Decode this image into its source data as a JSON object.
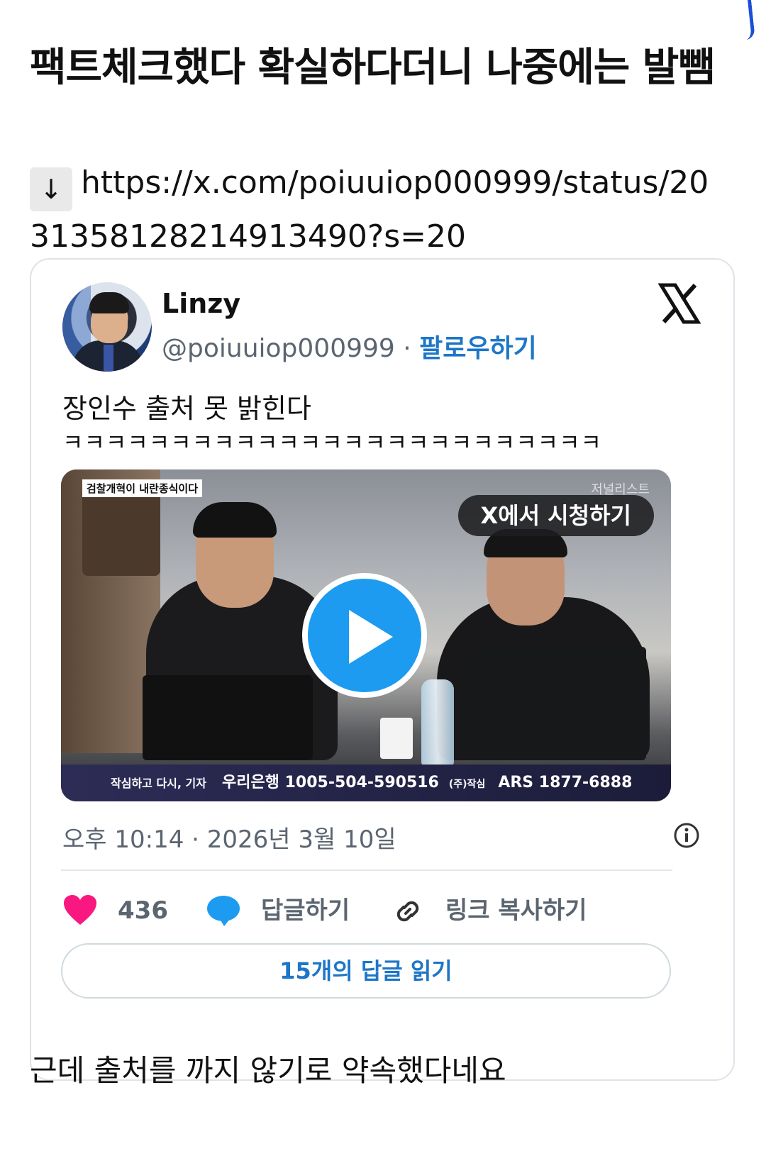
{
  "post": {
    "title": "팩트체크했다 확실하다더니 나중에는 발뺌",
    "link_arrow": "↓",
    "link_url": "https://x.com/poiuuiop000999/status/2031358128214913490?s=20",
    "footer_text": "근데 출처를 까지 않기로 약속했다네요"
  },
  "tweet": {
    "author_name": "Linzy",
    "handle": "@poiuuiop000999",
    "separator": " · ",
    "follow_label": "팔로우하기",
    "text_line1": "장인수 출처 못 밝힌다",
    "text_line2": "ㅋㅋㅋㅋㅋㅋㅋㅋㅋㅋㅋㅋㅋㅋㅋㅋㅋㅋㅋㅋㅋㅋㅋㅋㅋ",
    "timestamp": "오후 10:14 · 2026년 3월 10일",
    "likes_count": "436",
    "reply_label": "답글하기",
    "copy_link_label": "링크 복사하기",
    "read_replies_label": "15개의 답글 읽기"
  },
  "video": {
    "top_caption": "검찰개혁이 내란종식이다",
    "watermark": "저널리스트",
    "watch_label": "X에서 시청하기",
    "bottom_small": "작심하고 다시, 기자",
    "bottom_bank": "우리은행 1005-504-590516",
    "bottom_corp": "(주)작심",
    "bottom_ars": "ARS 1877-6888"
  },
  "colors": {
    "accent_blue": "#1d76c8",
    "play_blue": "#1d9bf0",
    "heart_pink": "#f91880",
    "reply_blue": "#1d9bf0"
  },
  "icons": [
    "x-logo-icon",
    "play-icon",
    "info-icon",
    "heart-icon",
    "reply-bubble-icon",
    "link-icon"
  ]
}
